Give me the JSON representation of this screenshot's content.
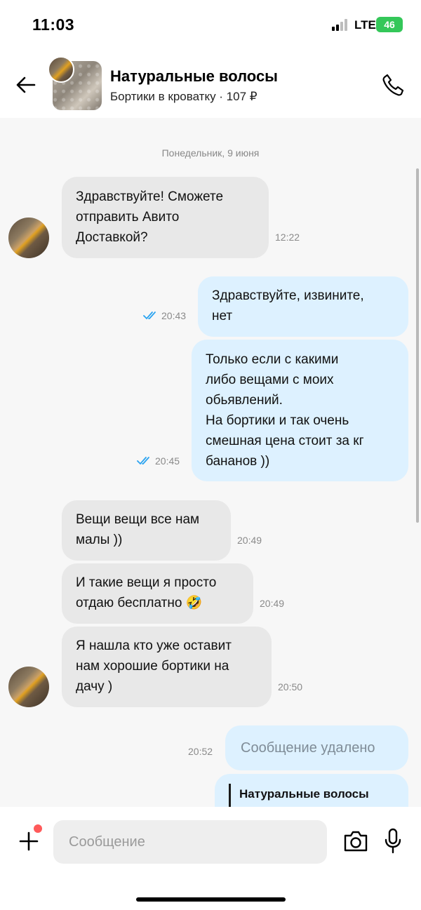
{
  "status_bar": {
    "time": "11:03",
    "network": "LTE",
    "battery": "46"
  },
  "header": {
    "title": "Натуральные волосы",
    "subtitle": "Бортики в кроватку · 107 ₽"
  },
  "chat": {
    "date": "Понедельник, 9 июня",
    "messages": [
      {
        "dir": "in",
        "text": "Здравствуйте! Сможете\nотправить Авито\nДоставкой?",
        "time": "12:22"
      },
      {
        "dir": "out",
        "text": "Здравствуйте, извините,\nнет",
        "time": "20:43"
      },
      {
        "dir": "out",
        "text": "Только если с какими\nлибо вещами с моих\nобьявлений.\nНа бортики и так очень\nсмешная цена стоит за кг\nбананов ))",
        "time": "20:45"
      },
      {
        "dir": "in",
        "text": "Вещи вещи все нам\nмалы ))",
        "time": "20:49"
      },
      {
        "dir": "in",
        "text": "И такие вещи я просто\nотдаю бесплатно 🤣",
        "time": "20:49"
      },
      {
        "dir": "in",
        "text": "Я нашла кто уже оставит\nнам хорошие бортики на\nдачу )",
        "time": "20:50"
      },
      {
        "dir": "out",
        "text": "Сообщение удалено",
        "time": "20:52"
      },
      {
        "dir": "out",
        "quote": "Натуральные волосы"
      }
    ]
  },
  "input": {
    "placeholder": "Сообщение"
  },
  "colors": {
    "incoming_bubble": "#e8e8e8",
    "outgoing_bubble": "#ddf1ff",
    "read_check": "#2aa3f0",
    "badge_dot": "#ff5a5a"
  },
  "icons": [
    "back-arrow-icon",
    "phone-icon",
    "double-check-icon",
    "plus-icon",
    "camera-icon",
    "microphone-icon"
  ]
}
